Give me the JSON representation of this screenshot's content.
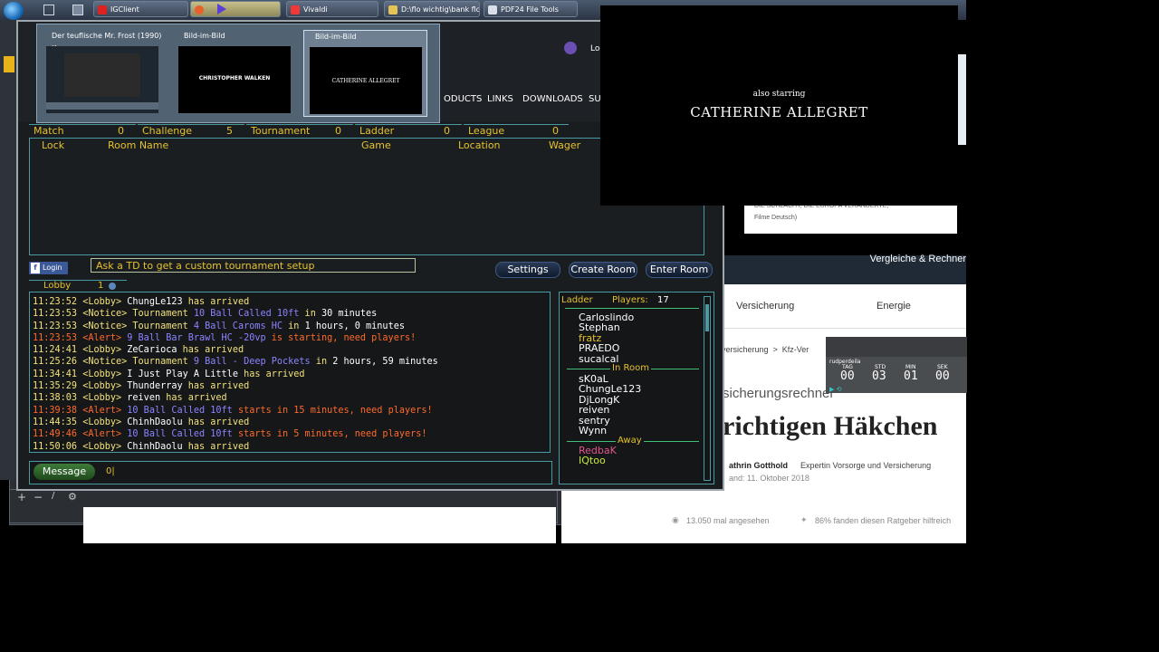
{
  "taskbar": {
    "tasks": [
      "IGClient",
      "",
      "Vivaldi",
      "D:\\flo wichtig\\bank flo",
      "PDF24 File Tools"
    ]
  },
  "thumbs": {
    "items": [
      {
        "label": "Der teuflische Mr. Frost (1990) K..."
      },
      {
        "label": "Bild-im-Bild",
        "text": "CHRISTOPHER WALKEN"
      },
      {
        "label": "Bild-im-Bild",
        "text": "CATHERINE ALLEGRET"
      }
    ]
  },
  "header": {
    "login_partial": "Log",
    "nav": [
      "ODUCTS",
      "LINKS",
      "DOWNLOADS",
      "SUP"
    ]
  },
  "tabs": [
    {
      "label": "Match",
      "count": "0"
    },
    {
      "label": "Challenge",
      "count": "5"
    },
    {
      "label": "Tournament",
      "count": "0"
    },
    {
      "label": "Ladder",
      "count": "0"
    },
    {
      "label": "League",
      "count": "0"
    }
  ],
  "columns": [
    "Lock",
    "Room Name",
    "Game",
    "Location",
    "Wager"
  ],
  "toolbar": {
    "login": "Login",
    "tip": "Ask a TD to get a custom tournament setup",
    "settings": "Settings",
    "create": "Create Room",
    "enter": "Enter Room"
  },
  "chat": {
    "tab_label": "Lobby",
    "tab_count": "1",
    "lines": [
      {
        "time": "11:23:52",
        "type": "<Lobby>",
        "parts": [
          [
            "w",
            "ChungLe123"
          ],
          [
            "y",
            " has arrived"
          ]
        ]
      },
      {
        "time": "11:23:53",
        "type": "<Notice>",
        "parts": [
          [
            "y",
            "Tournament "
          ],
          [
            "b",
            "10 Ball Called 10ft"
          ],
          [
            "y",
            " in "
          ],
          [
            "w",
            "30 minutes"
          ]
        ]
      },
      {
        "time": "11:23:53",
        "type": "<Notice>",
        "parts": [
          [
            "y",
            "Tournament "
          ],
          [
            "b",
            "4 Ball Caroms HC"
          ],
          [
            "y",
            " in "
          ],
          [
            "w",
            "1 hours, 0 minutes"
          ]
        ]
      },
      {
        "time": "11:23:53",
        "type": "<Alert>",
        "parts": [
          [
            "b",
            "9 Ball Bar Brawl HC -20vp"
          ],
          [
            "o",
            " is starting, need players!"
          ]
        ]
      },
      {
        "time": "11:24:41",
        "type": "<Lobby>",
        "parts": [
          [
            "w",
            "ZeCarioca"
          ],
          [
            "y",
            " has arrived"
          ]
        ]
      },
      {
        "time": "11:25:26",
        "type": "<Notice>",
        "parts": [
          [
            "y",
            "Tournament "
          ],
          [
            "b",
            "9 Ball - Deep Pockets"
          ],
          [
            "y",
            " in "
          ],
          [
            "w",
            "2 hours, 59 minutes"
          ]
        ]
      },
      {
        "time": "11:34:41",
        "type": "<Lobby>",
        "parts": [
          [
            "w",
            "I Just Play A Little"
          ],
          [
            "y",
            " has arrived"
          ]
        ]
      },
      {
        "time": "11:35:29",
        "type": "<Lobby>",
        "parts": [
          [
            "w",
            "Thunderray"
          ],
          [
            "y",
            " has arrived"
          ]
        ]
      },
      {
        "time": "11:38:03",
        "type": "<Lobby>",
        "parts": [
          [
            "w",
            "reiven"
          ],
          [
            "y",
            " has arrived"
          ]
        ]
      },
      {
        "time": "11:39:38",
        "type": "<Alert>",
        "parts": [
          [
            "b",
            "10 Ball Called 10ft"
          ],
          [
            "o",
            " starts in 15 minutes, need players!"
          ]
        ]
      },
      {
        "time": "11:44:35",
        "type": "<Lobby>",
        "parts": [
          [
            "w",
            "ChinhDaolu"
          ],
          [
            "y",
            " has arrived"
          ]
        ]
      },
      {
        "time": "11:49:46",
        "type": "<Alert>",
        "parts": [
          [
            "b",
            "10 Ball Called 10ft"
          ],
          [
            "o",
            " starts in 5 minutes, need players!"
          ]
        ]
      },
      {
        "time": "11:50:06",
        "type": "<Lobby>",
        "parts": [
          [
            "w",
            "ChinhDaolu"
          ],
          [
            "y",
            " has arrived"
          ]
        ]
      }
    ],
    "message_label": "Message",
    "message_value": "0|"
  },
  "players": {
    "ladder_label": "Ladder",
    "players_label": "Players:",
    "count": "17",
    "lobby": [
      "Carloslindo",
      "Stephan",
      "fratz",
      "PRAEDO",
      "sucalcal"
    ],
    "in_room_label": "In Room",
    "in_room": [
      "sK0aL",
      "ChungLe123",
      "DjLongK",
      "reiven",
      "sentry",
      "Wynn"
    ],
    "away_label": "Away",
    "away": [
      {
        "name": "RedbaK",
        "color": "#e0568e"
      },
      {
        "name": "IQtoo",
        "color": "#c8ea3c"
      }
    ]
  },
  "pip": {
    "line1": "also starring",
    "line2": "CATHERINE ALLEGRET"
  },
  "web": {
    "small1": "DIE SCHLACHT, DIE EUROPA VERÄNDERTE,",
    "small2": "Filme Deutsch)",
    "vergleiche": "Vergleiche & Rechner",
    "nav1": "Versicherung",
    "nav2": "Energie",
    "crumb": "oversicherung  >  Kfz-Ver",
    "sub": "sicherungsrechner",
    "headline": "richtigen Häkchen",
    "author": "athrin Gotthold",
    "role": "Expertin Vorsorge und Versicherung",
    "date": "and: 11. Oktober 2018",
    "views": "13.050 mal angesehen",
    "helpful": "86% fanden diesen Ratgeber hilfreich"
  },
  "timer": {
    "label": "rudperdeila",
    "units": [
      "TAG",
      "STD",
      "MIN",
      "SEK"
    ],
    "values": [
      "00",
      "03",
      "01",
      "00"
    ]
  }
}
